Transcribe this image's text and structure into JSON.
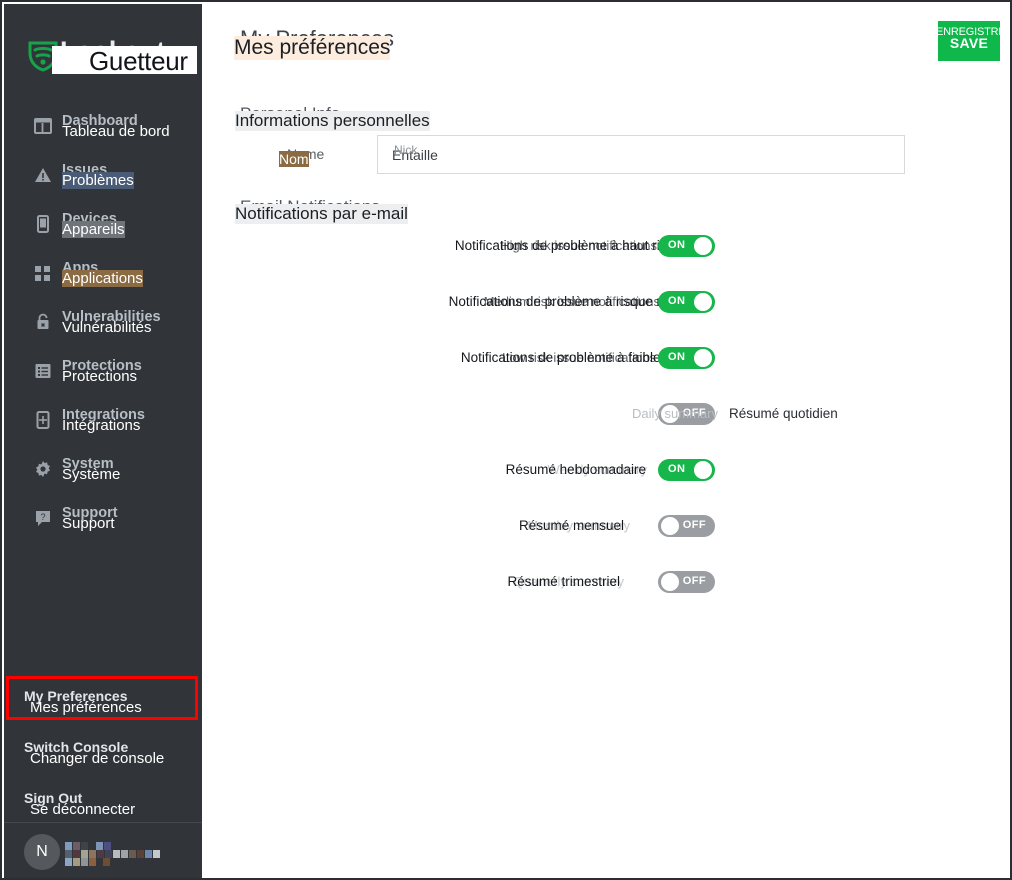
{
  "brand": {
    "name_en": "Lookout",
    "name_fr": "Guetteur",
    "logo_icon": "lookout-shield-icon"
  },
  "sidebar": {
    "items": [
      {
        "label_en": "Dashboard",
        "label_fr": "Tableau de bord",
        "icon": "dashboard-icon",
        "highlight": "none"
      },
      {
        "label_en": "Issues",
        "label_fr": "Problèmes",
        "icon": "warning-triangle-icon",
        "highlight": "blue"
      },
      {
        "label_en": "Devices",
        "label_fr": "Appareils",
        "icon": "device-icon",
        "highlight": "grey"
      },
      {
        "label_en": "Apps",
        "label_fr": "Applications",
        "icon": "apps-grid-icon",
        "highlight": "tan"
      },
      {
        "label_en": "Vulnerabilities",
        "label_fr": "Vulnérabilités",
        "icon": "lock-icon",
        "highlight": "none"
      },
      {
        "label_en": "Protections",
        "label_fr": "Protections",
        "icon": "list-icon",
        "highlight": "none"
      },
      {
        "label_en": "Integrations",
        "label_fr": "Intégrations",
        "icon": "integration-icon",
        "highlight": "none"
      },
      {
        "label_en": "System",
        "label_fr": "Système",
        "icon": "gear-icon",
        "highlight": "none"
      },
      {
        "label_en": "Support",
        "label_fr": "Support",
        "icon": "help-bubble-icon",
        "highlight": "none"
      }
    ],
    "bottom_links": [
      {
        "label_en": "My Preferences",
        "label_fr": "Mes préférences",
        "selected": true
      },
      {
        "label_en": "Switch Console",
        "label_fr": "Changer de console",
        "selected": false
      },
      {
        "label_en": "Sign Out",
        "label_fr": "Se déconnecter",
        "selected": false
      }
    ],
    "user": {
      "avatar_initial": "N",
      "name_redacted": true
    },
    "highlight_color": "#ff0000"
  },
  "main": {
    "page_title_en": "My Preferences",
    "page_title_fr": "Mes préférences",
    "save_button": {
      "label_en": "SAVE",
      "label_fr": "ENREGISTRER",
      "color": "#0fb84a"
    },
    "personal_info": {
      "section_en": "Personal Info",
      "section_fr": "Informations personnelles",
      "name_label_en": "Name",
      "name_label_fr": "Nom",
      "name_value_en": "Nick",
      "name_value_fr": "Entaille",
      "name_placeholder": "Nom"
    },
    "email_notifications": {
      "section_en": "Email Notifications",
      "section_fr": "Notifications par e-mail",
      "rows": [
        {
          "label_en": "High risk issue notifications",
          "label_fr": "Notifications de problème à haut risque",
          "state": "ON",
          "label_side": "left"
        },
        {
          "label_en": "Medium risk issue notifications",
          "label_fr": "Notifications de problème à risque moyen",
          "state": "ON",
          "label_side": "left"
        },
        {
          "label_en": "Low risk issue notifications",
          "label_fr": "Notifications de problème à faible risque",
          "state": "ON",
          "label_side": "left"
        },
        {
          "label_en": "Daily summary",
          "label_fr": "Résumé quotidien",
          "state": "OFF",
          "label_side": "right"
        },
        {
          "label_en": "Weekly summary",
          "label_fr": "Résumé hebdomadaire",
          "state": "ON",
          "label_side": "left"
        },
        {
          "label_en": "Monthly summary",
          "label_fr": "Résumé mensuel",
          "state": "OFF",
          "label_side": "left"
        },
        {
          "label_en": "Quarterly summary",
          "label_fr": "Résumé trimestriel",
          "state": "OFF",
          "label_side": "left"
        }
      ]
    }
  }
}
